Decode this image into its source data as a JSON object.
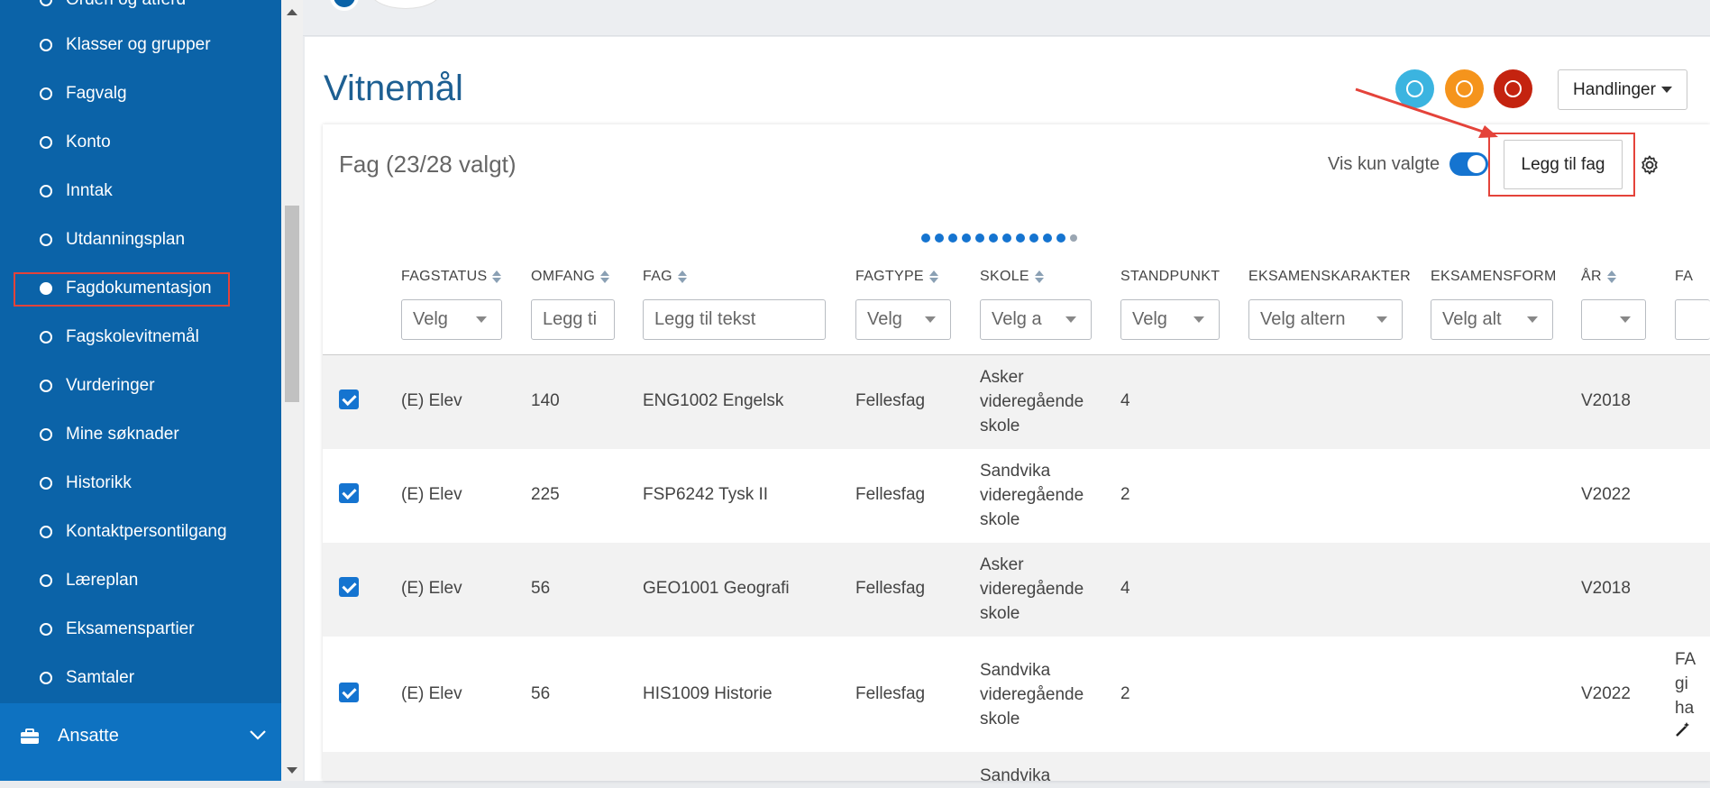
{
  "sidebar": {
    "items": [
      {
        "label": "Orden og atferd"
      },
      {
        "label": "Klasser og grupper"
      },
      {
        "label": "Fagvalg"
      },
      {
        "label": "Konto"
      },
      {
        "label": "Inntak"
      },
      {
        "label": "Utdanningsplan"
      },
      {
        "label": "Fagdokumentasjon",
        "active": true
      },
      {
        "label": "Fagskolevitnemål"
      },
      {
        "label": "Vurderinger"
      },
      {
        "label": "Mine søknader"
      },
      {
        "label": "Historikk"
      },
      {
        "label": "Kontaktpersontilgang"
      },
      {
        "label": "Læreplan"
      },
      {
        "label": "Eksamenspartier"
      },
      {
        "label": "Samtaler"
      }
    ],
    "section": {
      "label": "Ansatte",
      "icon": "briefcase-icon"
    }
  },
  "colors": {
    "sidebar": "#0b63a8",
    "accent": "#1574d0",
    "title": "#1d5f92",
    "highlight": "#e4433a",
    "circle_blue": "#3bb4e0",
    "circle_orange": "#f5941c",
    "circle_red": "#c4230f"
  },
  "page": {
    "title": "Vitnemål",
    "actions_label": "Handlinger"
  },
  "card": {
    "header": "Fag (23/28 valgt)",
    "toggle_label": "Vis kun valgte",
    "toggle_on": true,
    "add_button": "Legg til fag"
  },
  "columns": [
    {
      "label": "FAGSTATUS",
      "sortable": true,
      "filter": "Velg",
      "filter_type": "select"
    },
    {
      "label": "OMFANG",
      "sortable": true,
      "filter": "Legg ti",
      "filter_type": "text"
    },
    {
      "label": "FAG",
      "sortable": true,
      "filter": "Legg til tekst",
      "filter_type": "text"
    },
    {
      "label": "FAGTYPE",
      "sortable": true,
      "filter": "Velg",
      "filter_type": "select"
    },
    {
      "label": "SKOLE",
      "sortable": true,
      "filter": "Velg a",
      "filter_type": "select"
    },
    {
      "label": "STANDPUNKT",
      "sortable": false,
      "filter": "Velg",
      "filter_type": "select"
    },
    {
      "label": "EKSAMENSKARAKTER",
      "sortable": false,
      "filter": "Velg altern",
      "filter_type": "select"
    },
    {
      "label": "EKSAMENSFORM",
      "sortable": false,
      "filter": "Velg alt",
      "filter_type": "select"
    },
    {
      "label": "ÅR",
      "sortable": true,
      "filter": "",
      "filter_type": "select"
    },
    {
      "label": "FA",
      "sortable": false,
      "filter": "",
      "filter_type": "text"
    }
  ],
  "rows": [
    {
      "checked": true,
      "status": "(E) Elev",
      "omfang": "140",
      "fag": "ENG1002 Engelsk",
      "fagtype": "Fellesfag",
      "skole": [
        "Asker",
        "videregående",
        "skole"
      ],
      "standpunkt": "4",
      "ar": "V2018"
    },
    {
      "checked": true,
      "status": "(E) Elev",
      "omfang": "225",
      "fag": "FSP6242 Tysk II",
      "fagtype": "Fellesfag",
      "skole": [
        "Sandvika",
        "videregående",
        "skole"
      ],
      "standpunkt": "2",
      "ar": "V2022"
    },
    {
      "checked": true,
      "status": "(E) Elev",
      "omfang": "56",
      "fag": "GEO1001 Geografi",
      "fagtype": "Fellesfag",
      "skole": [
        "Asker",
        "videregående",
        "skole"
      ],
      "standpunkt": "4",
      "ar": "V2018"
    },
    {
      "checked": true,
      "status": "(E) Elev",
      "omfang": "56",
      "fag": "HIS1009 Historie",
      "fagtype": "Fellesfag",
      "skole": [
        "Sandvika",
        "videregående",
        "skole"
      ],
      "standpunkt": "2",
      "ar": "V2022",
      "extra": [
        "FA",
        "gi",
        "ha"
      ]
    },
    {
      "skole": [
        "Sandvika"
      ]
    }
  ]
}
